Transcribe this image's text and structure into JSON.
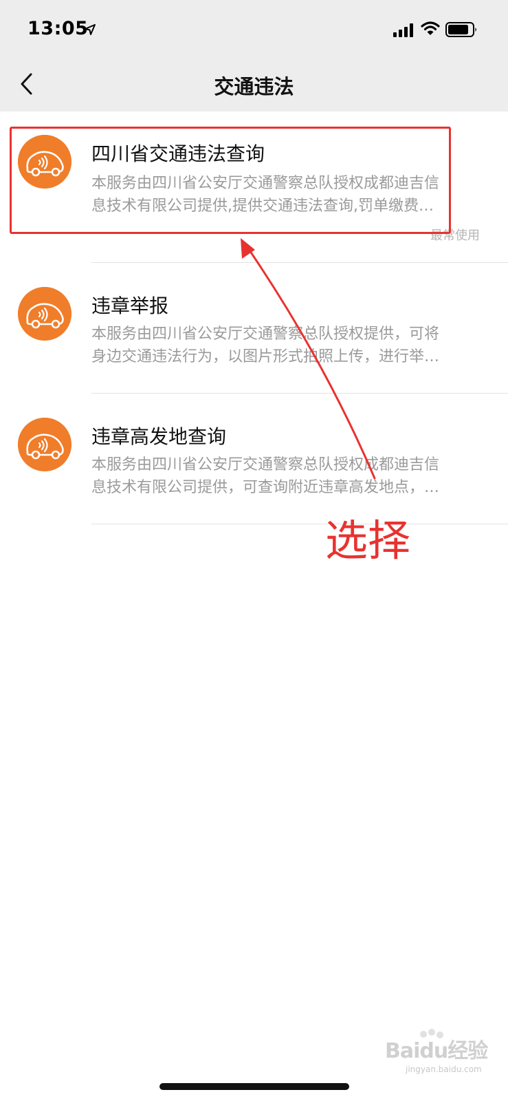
{
  "status_bar": {
    "time": "13:05",
    "icons": [
      "location-arrow-icon",
      "signal-icon",
      "wifi-icon",
      "battery-icon"
    ]
  },
  "nav": {
    "back_icon": "chevron-left-icon",
    "title": "交通违法"
  },
  "items": [
    {
      "title": "四川省交通违法查询",
      "desc_line1": "本服务由四川省公安厅交通警察总队授权成都迪吉信",
      "desc_line2": "息技术有限公司提供,提供交通违法查询,罚单缴费…",
      "tag": "最常使用"
    },
    {
      "title": "违章举报",
      "desc_line1": "本服务由四川省公安厅交通警察总队授权提供，可将",
      "desc_line2": "身边交通违法行为，以图片形式拍照上传，进行举…"
    },
    {
      "title": "违章高发地查询",
      "desc_line1": "本服务由四川省公安厅交通警察总队授权成都迪吉信",
      "desc_line2": "息技术有限公司提供，可查询附近违章高发地点，…"
    }
  ],
  "annotation": {
    "label": "选择",
    "color": "#e8322f"
  },
  "watermark": {
    "text": "Baidu经验",
    "sub": "jingyan.baidu.com"
  },
  "colors": {
    "header_bg": "#ededed",
    "avatar_orange": "#f07d2a",
    "desc_gray": "#9a9a9a"
  }
}
